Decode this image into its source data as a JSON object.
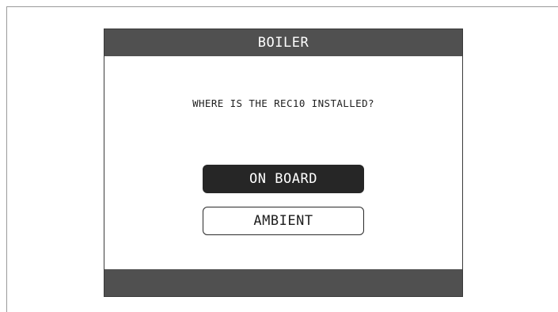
{
  "header": {
    "title": "BOILER"
  },
  "dialog": {
    "question": "WHERE IS THE REC10 INSTALLED?",
    "options": [
      {
        "label": "ON BOARD",
        "selected": true
      },
      {
        "label": "AMBIENT",
        "selected": false
      }
    ]
  },
  "colors": {
    "bar": "#505050",
    "selected_bg": "#262626",
    "selected_text": "#ffffff",
    "background": "#ffffff"
  }
}
